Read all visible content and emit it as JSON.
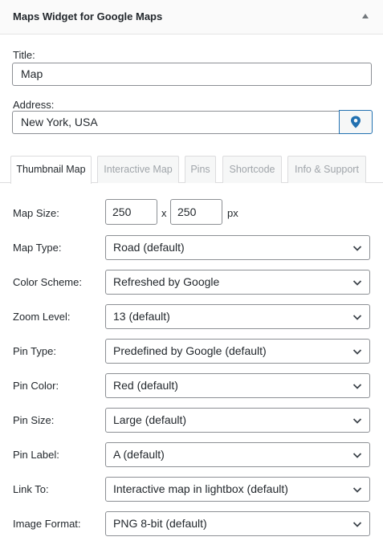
{
  "widget": {
    "title": "Maps Widget for Google Maps"
  },
  "form": {
    "title_label": "Title:",
    "title_value": "Map",
    "address_label": "Address:",
    "address_value": "New York, USA"
  },
  "tabs": [
    {
      "label": "Thumbnail Map",
      "active": true
    },
    {
      "label": "Interactive Map",
      "active": false
    },
    {
      "label": "Pins",
      "active": false
    },
    {
      "label": "Shortcode",
      "active": false
    },
    {
      "label": "Info & Support",
      "active": false
    }
  ],
  "thumbnail": {
    "map_size_label": "Map Size:",
    "width": "250",
    "separator": "x",
    "height": "250",
    "unit": "px",
    "fields": [
      {
        "label": "Map Type:",
        "value": "Road (default)"
      },
      {
        "label": "Color Scheme:",
        "value": "Refreshed by Google"
      },
      {
        "label": "Zoom Level:",
        "value": "13 (default)"
      },
      {
        "label": "Pin Type:",
        "value": "Predefined by Google (default)"
      },
      {
        "label": "Pin Color:",
        "value": "Red (default)"
      },
      {
        "label": "Pin Size:",
        "value": "Large (default)"
      },
      {
        "label": "Pin Label:",
        "value": "A (default)"
      },
      {
        "label": "Link To:",
        "value": "Interactive map in lightbox (default)"
      },
      {
        "label": "Image Format:",
        "value": "PNG 8-bit (default)"
      }
    ]
  },
  "colors": {
    "accent": "#2271b1",
    "border": "#8c8f94",
    "text": "#23282d"
  }
}
